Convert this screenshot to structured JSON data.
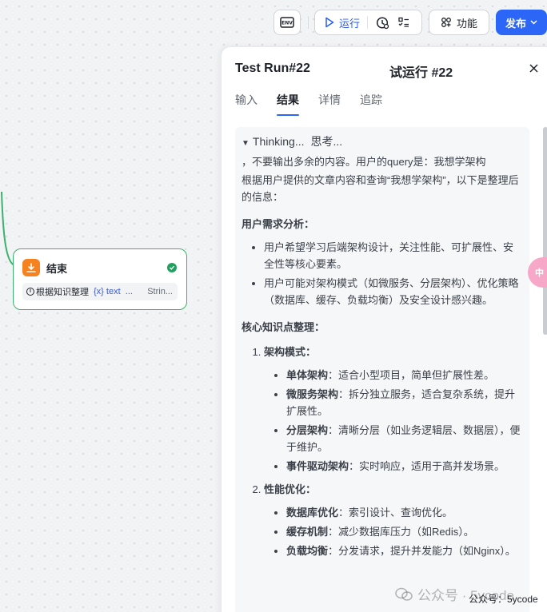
{
  "toolbar": {
    "env_label": "ENV",
    "run_label": "运行",
    "function_label": "功能",
    "publish_label": "发布"
  },
  "node": {
    "title": "结束",
    "var_label": "根据知识整理",
    "var_ref": "{x} text",
    "var_ref_more": "...",
    "var_type": "Strin...",
    "icon": "end-node-icon",
    "accent": "#3ab16c"
  },
  "panel": {
    "title_en": "Test Run#22",
    "title_cn": "试运行 #22",
    "tabs": [
      "输入",
      "结果",
      "详情",
      "追踪"
    ],
    "active_tab": "结果"
  },
  "result": {
    "thinking_en": "Thinking...",
    "thinking_cn": "思考...",
    "intro": "，不要输出多余的内容。用户的query是：我想学架构",
    "summary": "根据用户提供的文章内容和查询“我想学架构”，以下是整理后的信息：",
    "section1_title": "用户需求分析：",
    "section1_items": [
      "用户希望学习后端架构设计，关注性能、可扩展性、安全性等核心要素。",
      "用户可能对架构模式（如微服务、分层架构）、优化策略（数据库、缓存、负载均衡）及安全设计感兴趣。"
    ],
    "section2_title": "核心知识点整理：",
    "groups": [
      {
        "title": "架构模式：",
        "items": [
          {
            "term": "单体架构",
            "desc": "：适合小型项目，简单但扩展性差。"
          },
          {
            "term": "微服务架构",
            "desc": "：拆分独立服务，适合复杂系统，提升扩展性。"
          },
          {
            "term": "分层架构",
            "desc": "：清晰分层（如业务逻辑层、数据层），便于维护。"
          },
          {
            "term": "事件驱动架构",
            "desc": "：实时响应，适用于高并发场景。"
          }
        ]
      },
      {
        "title": "性能优化：",
        "items": [
          {
            "term": "数据库优化",
            "desc": "：索引设计、查询优化。"
          },
          {
            "term": "缓存机制",
            "desc": "：减少数据库压力（如Redis）。"
          },
          {
            "term": "负载均衡",
            "desc": "：分发请求，提升并发能力（如Nginx）。"
          }
        ]
      }
    ]
  },
  "float_tab": "中",
  "watermark": {
    "text": "公众号 · 5ycode",
    "plain": "公众号：5ycode"
  },
  "colors": {
    "primary": "#2b66f6",
    "success": "#22a060",
    "node_icon": "#f5811f"
  }
}
